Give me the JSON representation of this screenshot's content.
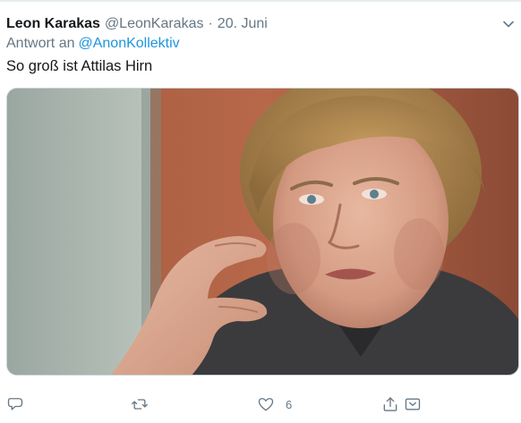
{
  "tweet": {
    "author": "Leon Karakas",
    "handle": "@LeonKarakas",
    "separator": "·",
    "date": "20. Juni",
    "reply_prefix": "Antwort an",
    "reply_mention": "@AnonKollektiv",
    "text": "So groß ist Attilas Hirn"
  },
  "media": {
    "description": "photo-woman-hand-gesture"
  },
  "actions": {
    "reply_icon": "comment-icon",
    "retweet_icon": "retweet-icon",
    "like_icon": "heart-icon",
    "like_count": "6",
    "share_icon": "share-icon",
    "dm_icon": "direct-message-icon"
  },
  "colors": {
    "text": "#14171a",
    "secondary": "#657786",
    "link": "#1b95e0",
    "border": "#ccd6dd"
  }
}
